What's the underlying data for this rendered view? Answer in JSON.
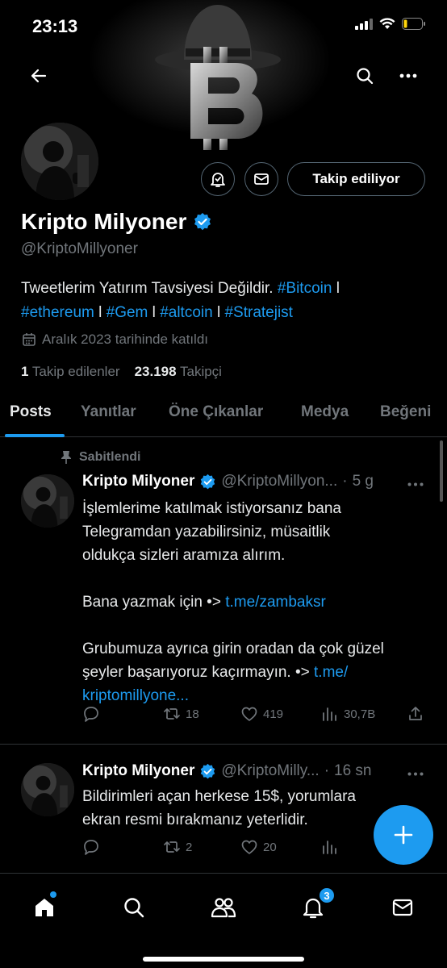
{
  "status_bar": {
    "time": "23:13"
  },
  "profile": {
    "name": "Kripto Milyoner",
    "handle": "@KriptoMillyoner",
    "bio_text": "Tweetlerim Yatırım Tavsiyesi Değildir.",
    "bio_tags_line1": [
      "#Bitcoin"
    ],
    "bio_tags_line2": [
      "#ethereum",
      "#Gem",
      "#altcoin",
      "#Stratejist"
    ],
    "separator": "l",
    "joined": "Aralık 2023 tarihinde katıldı",
    "following_count": "1",
    "following_label": "Takip edilenler",
    "followers_count": "23.198",
    "followers_label": "Takipçi",
    "follow_button": "Takip ediliyor"
  },
  "tabs": [
    "Posts",
    "Yanıtlar",
    "Öne Çıkanlar",
    "Medya",
    "Beğeni"
  ],
  "posts": [
    {
      "pinned_label": "Sabitlendi",
      "name": "Kripto Milyoner",
      "handle": "@KriptoMillyon...",
      "time": "5 g",
      "text_line1": "İşlemlerime katılmak istiyorsanız bana",
      "text_line2": "Telegramdan yazabilirsiniz, müsaitlik",
      "text_line3": "oldukça sizleri aramıza alırım.",
      "text_line4": "Bana yazmak için •>",
      "link1": "t.me/zambaksr",
      "text_line5": "Grubumuza ayrıca girin oradan da çok güzel",
      "text_line6": "şeyler başarıyoruz kaçırmayın. •>",
      "link2a": "t.me/",
      "link2b": "kriptomillyone...",
      "reposts": "18",
      "likes": "419",
      "views": "30,7B"
    },
    {
      "name": "Kripto Milyoner",
      "handle": "@KriptoMilly...",
      "time": "16 sn",
      "text_line1": "Bildirimleri açan herkese 15$, yorumlara",
      "text_line2": "ekran resmi bırakmanız yeterlidir.",
      "reposts": "2",
      "likes": "20"
    }
  ],
  "bottom_nav": {
    "notifications_badge": "3"
  },
  "colors": {
    "accent": "#1d9bf0",
    "muted": "#71767b",
    "border": "#2f3336"
  }
}
